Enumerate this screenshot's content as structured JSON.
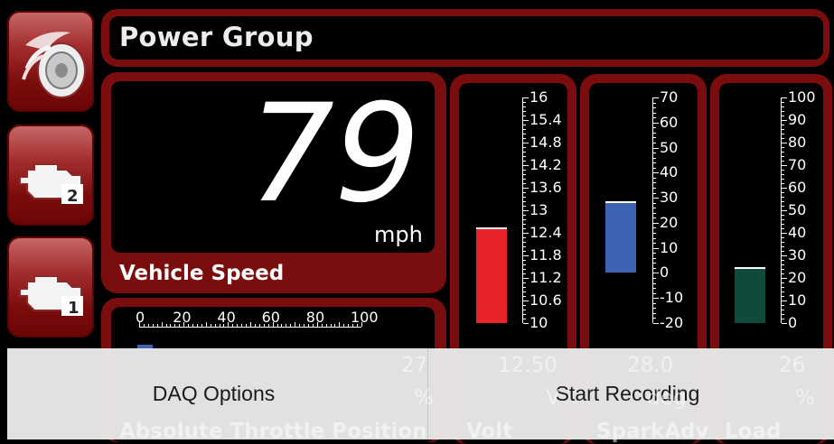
{
  "title": "Power Group",
  "sidebar": {
    "items": [
      {
        "icon": "tire-icon"
      },
      {
        "icon": "engine-2-icon",
        "badge": "2"
      },
      {
        "icon": "engine-1-icon",
        "badge": "1"
      }
    ]
  },
  "speed": {
    "value": "79",
    "unit": "mph",
    "label": "Vehicle Speed"
  },
  "throttle": {
    "scale": [
      "0",
      "20",
      "40",
      "60",
      "80",
      "100"
    ],
    "value_fraction": 0.27,
    "value": "27",
    "unit": "%",
    "label": "Absolute Throttle Position"
  },
  "gauges": [
    {
      "name": "Volt",
      "value": "12.50",
      "unit": "V",
      "min": 10,
      "max": 16,
      "reading": 12.5,
      "color": "#e8232a",
      "ticks": [
        "16",
        "15.4",
        "14.8",
        "14.2",
        "13.6",
        "13",
        "12.4",
        "11.8",
        "11.2",
        "10.6",
        "10"
      ]
    },
    {
      "name": "SparkAdv",
      "value": "28.0",
      "unit": "deg",
      "min": -20,
      "max": 70,
      "reading": 28,
      "base": 0,
      "color": "#3d63b3",
      "ticks": [
        "70",
        "60",
        "50",
        "40",
        "30",
        "20",
        "10",
        "0",
        "-10",
        "-20"
      ]
    },
    {
      "name": "Load",
      "value": "26",
      "unit": "%",
      "min": 0,
      "max": 100,
      "reading": 24,
      "color": "#0f4a3a",
      "ticks": [
        "100",
        "90",
        "80",
        "70",
        "60",
        "50",
        "40",
        "30",
        "20",
        "10",
        "0"
      ]
    }
  ],
  "menu": {
    "daq": "DAQ Options",
    "record": "Start Recording"
  }
}
